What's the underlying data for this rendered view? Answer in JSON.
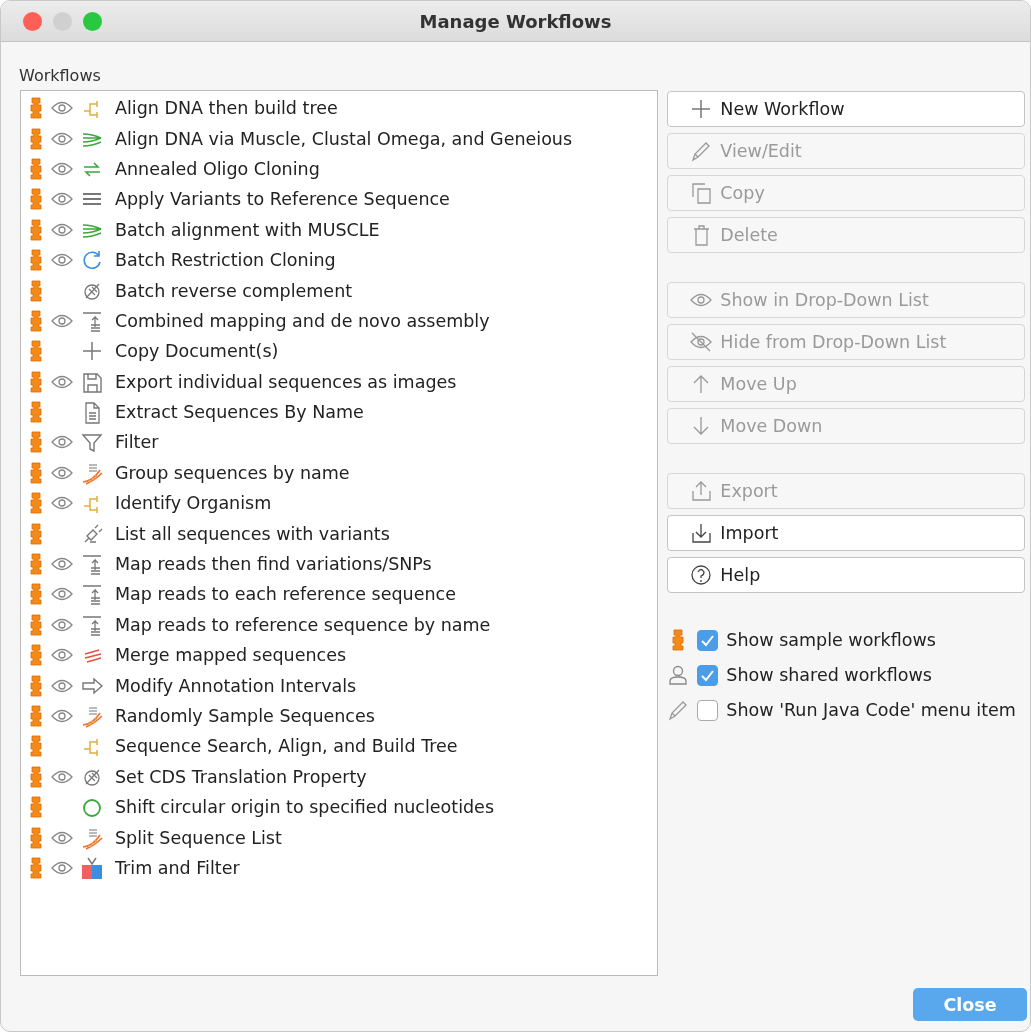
{
  "window": {
    "title": "Manage Workflows"
  },
  "list_label": "Workflows",
  "workflows": [
    {
      "label": "Align DNA then build tree",
      "sample": true,
      "visible": true,
      "kind": "tree"
    },
    {
      "label": "Align DNA via Muscle, Clustal Omega, and Geneious",
      "sample": true,
      "visible": true,
      "kind": "align"
    },
    {
      "label": "Annealed Oligo Cloning",
      "sample": true,
      "visible": true,
      "kind": "anneal"
    },
    {
      "label": "Apply Variants to Reference Sequence",
      "sample": true,
      "visible": true,
      "kind": "lines"
    },
    {
      "label": "Batch alignment with MUSCLE",
      "sample": true,
      "visible": true,
      "kind": "align"
    },
    {
      "label": "Batch Restriction Cloning",
      "sample": true,
      "visible": true,
      "kind": "refresh"
    },
    {
      "label": "Batch reverse complement",
      "sample": true,
      "visible": false,
      "kind": "dnagray"
    },
    {
      "label": "Combined mapping and de novo assembly",
      "sample": true,
      "visible": true,
      "kind": "map"
    },
    {
      "label": "Copy Document(s)",
      "sample": true,
      "visible": false,
      "kind": "plus"
    },
    {
      "label": "Export individual sequences as images",
      "sample": true,
      "visible": true,
      "kind": "save"
    },
    {
      "label": "Extract Sequences By Name",
      "sample": true,
      "visible": false,
      "kind": "doc"
    },
    {
      "label": "Filter",
      "sample": true,
      "visible": true,
      "kind": "filter"
    },
    {
      "label": "Group sequences by name",
      "sample": true,
      "visible": true,
      "kind": "dnacolor"
    },
    {
      "label": "Identify Organism",
      "sample": true,
      "visible": true,
      "kind": "tree"
    },
    {
      "label": "List all sequences with variants",
      "sample": true,
      "visible": false,
      "kind": "plug"
    },
    {
      "label": "Map reads then find variations/SNPs",
      "sample": true,
      "visible": true,
      "kind": "map"
    },
    {
      "label": "Map reads to each reference sequence",
      "sample": true,
      "visible": true,
      "kind": "map"
    },
    {
      "label": "Map reads to reference sequence by name",
      "sample": true,
      "visible": true,
      "kind": "map"
    },
    {
      "label": "Merge mapped sequences",
      "sample": true,
      "visible": true,
      "kind": "merge"
    },
    {
      "label": "Modify Annotation Intervals",
      "sample": true,
      "visible": true,
      "kind": "arrow"
    },
    {
      "label": "Randomly Sample Sequences",
      "sample": true,
      "visible": true,
      "kind": "dnacolor"
    },
    {
      "label": "Sequence Search, Align, and Build Tree",
      "sample": true,
      "visible": false,
      "kind": "tree"
    },
    {
      "label": "Set CDS Translation Property",
      "sample": true,
      "visible": true,
      "kind": "dnagray"
    },
    {
      "label": "Shift circular origin to specified nucleotides",
      "sample": true,
      "visible": false,
      "kind": "circle"
    },
    {
      "label": "Split Sequence List",
      "sample": true,
      "visible": true,
      "kind": "dnacolor"
    },
    {
      "label": "Trim and Filter",
      "sample": true,
      "visible": true,
      "kind": "trim"
    }
  ],
  "button_groups": [
    [
      {
        "label": "New Workflow",
        "kind": "plus",
        "disabled": false
      },
      {
        "label": "View/Edit",
        "kind": "pencil",
        "disabled": true
      },
      {
        "label": "Copy",
        "kind": "copy",
        "disabled": true
      },
      {
        "label": "Delete",
        "kind": "trash",
        "disabled": true
      }
    ],
    [
      {
        "label": "Show in Drop-Down List",
        "kind": "eye",
        "disabled": true
      },
      {
        "label": "Hide from Drop-Down List",
        "kind": "eyeoff",
        "disabled": true
      },
      {
        "label": "Move Up",
        "kind": "up",
        "disabled": true
      },
      {
        "label": "Move Down",
        "kind": "down",
        "disabled": true
      }
    ],
    [
      {
        "label": "Export",
        "kind": "export",
        "disabled": true
      },
      {
        "label": "Import",
        "kind": "import",
        "disabled": false
      },
      {
        "label": "Help",
        "kind": "help",
        "disabled": false
      }
    ]
  ],
  "options": [
    {
      "label": "Show sample workflows",
      "kind": "sample",
      "checked": true
    },
    {
      "label": "Show shared workflows",
      "kind": "person",
      "checked": true
    },
    {
      "label": "Show 'Run Java Code' menu item",
      "kind": "pencil",
      "checked": false
    }
  ],
  "close_button": "Close"
}
